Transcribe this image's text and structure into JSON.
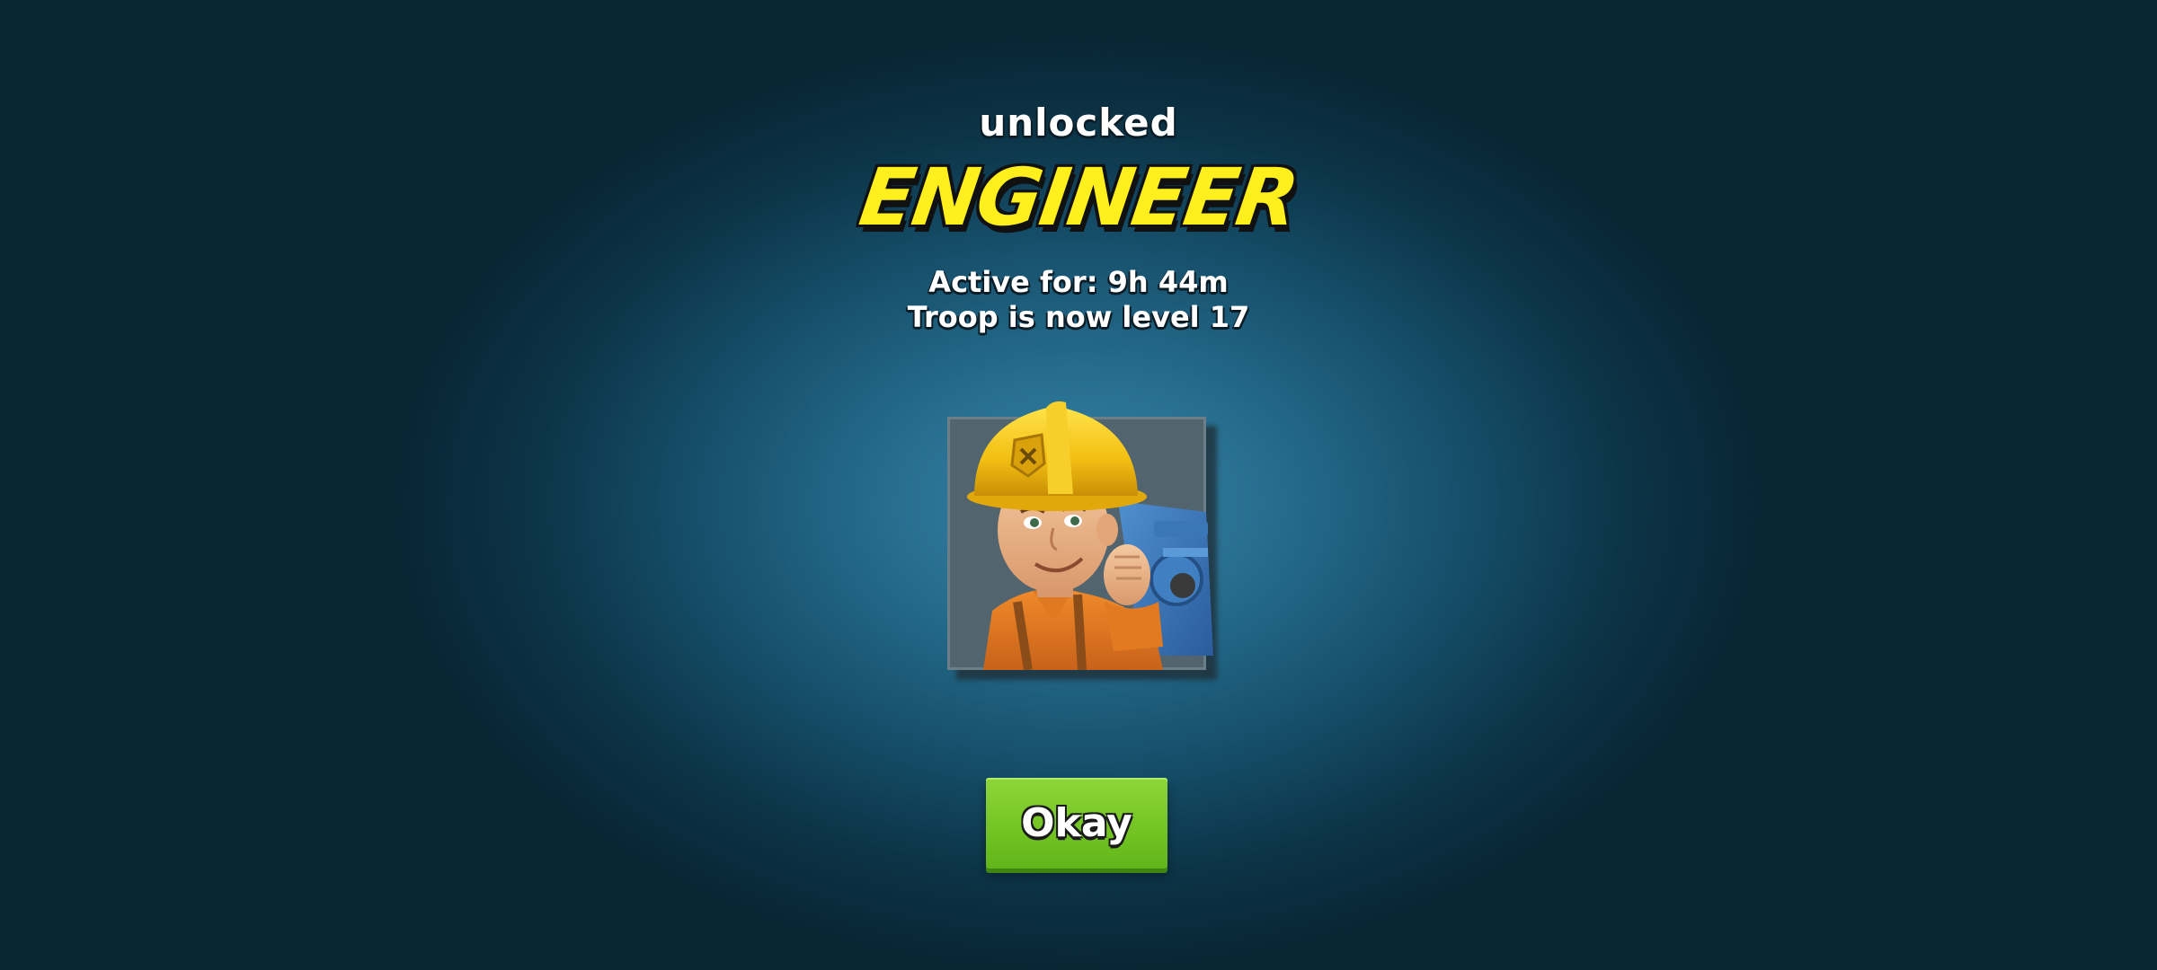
{
  "popup": {
    "heading": "unlocked",
    "troop_name": "ENGINEER",
    "active_for": "Active for: 9h 44m",
    "level_text": "Troop is now level 17"
  },
  "portrait": {
    "icon": "engineer-portrait"
  },
  "buttons": {
    "okay_label": "Okay"
  },
  "colors": {
    "title_yellow": "#ffef1c",
    "button_green": "#72c323",
    "background_center": "#3a86a8",
    "background_edge": "#082634"
  }
}
